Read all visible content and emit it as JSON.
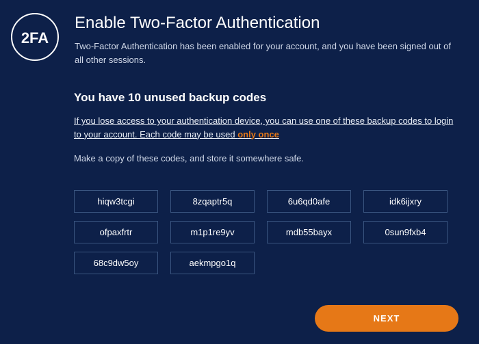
{
  "header": {
    "icon_label": "2FA",
    "title": "Enable Two-Factor Authentication",
    "subtitle": "Two-Factor Authentication has been enabled for your account, and you have been signed out of all other sessions."
  },
  "section": {
    "heading": "You have 10 unused backup codes",
    "warning_prefix": "If you lose access to your authentication device, you can use one of these backup codes to login to your account.  Each code may be used ",
    "warning_highlight": "only once",
    "instruction": "Make a copy of these codes, and store it somewhere safe."
  },
  "codes": [
    "hiqw3tcgi",
    "8zqaptr5q",
    "6u6qd0afe",
    "idk6ijxry",
    "ofpaxfrtr",
    "m1p1re9yv",
    "mdb55bayx",
    "0sun9fxb4",
    "68c9dw5oy",
    "aekmpgo1q"
  ],
  "footer": {
    "next_label": "NEXT"
  }
}
